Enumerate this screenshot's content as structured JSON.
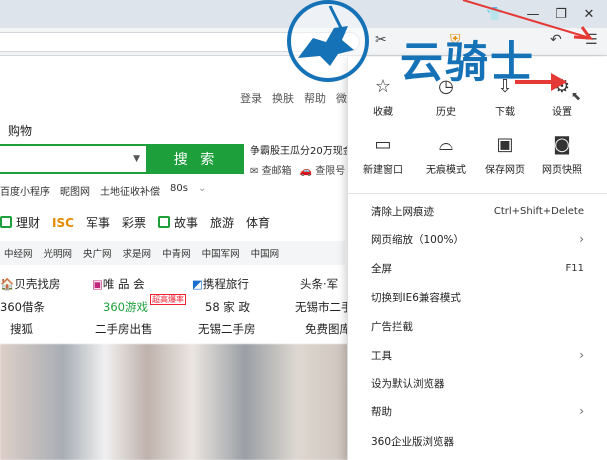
{
  "window": {
    "controls": [
      "shirt-icon",
      "minimize-icon",
      "restore-icon",
      "close-icon"
    ]
  },
  "page": {
    "toplinks": [
      "登录",
      "换肤",
      "帮助",
      "微"
    ],
    "tab": "购物",
    "search_button": "搜 索",
    "promo": "争霸股王瓜分20万现金",
    "promo_links": [
      "查邮箱",
      "查限号"
    ],
    "quick_links": [
      "百度小程序",
      "昵图网",
      "土地征收补偿",
      "80s"
    ],
    "categories": [
      "理财",
      "ISC",
      "军事",
      "彩票",
      "故事",
      "旅游",
      "体育"
    ],
    "linkbar": [
      "中经网",
      "光明网",
      "央广网",
      "求是网",
      "中青网",
      "中国军网",
      "中国网"
    ],
    "sites": {
      "r1": [
        "贝壳找房",
        "唯 品 会",
        "携程旅行",
        "头条·军"
      ],
      "r2": [
        "360借条",
        "360游戏",
        "58 家 政",
        "无锡市二手"
      ],
      "r3": [
        "搜狐",
        "二手房出售",
        "无锡二手房",
        "免费图库"
      ],
      "hot_badge": "超高爆率"
    }
  },
  "menu": {
    "grid": [
      {
        "label": "收藏",
        "icon": "star-icon"
      },
      {
        "label": "历史",
        "icon": "clock-icon"
      },
      {
        "label": "下载",
        "icon": "download-icon"
      },
      {
        "label": "设置",
        "icon": "gear-icon"
      },
      {
        "label": "新建窗口",
        "icon": "window-icon"
      },
      {
        "label": "无痕模式",
        "icon": "incognito-icon"
      },
      {
        "label": "保存网页",
        "icon": "save-icon"
      },
      {
        "label": "网页快照",
        "icon": "camera-icon"
      }
    ],
    "items": [
      {
        "label": "清除上网痕迹",
        "shortcut": "Ctrl+Shift+Delete"
      },
      {
        "label": "网页缩放（100%）",
        "shortcut": "›"
      },
      {
        "label": "全屏",
        "shortcut": "F11"
      },
      {
        "label": "切换到IE6兼容模式",
        "shortcut": ""
      },
      {
        "label": "广告拦截",
        "shortcut": ""
      },
      {
        "label": "工具",
        "shortcut": "›"
      },
      {
        "label": "设为默认浏览器",
        "shortcut": ""
      },
      {
        "label": "帮助",
        "shortcut": "›"
      },
      {
        "label": "360企业版浏览器",
        "shortcut": ""
      }
    ]
  },
  "logo": {
    "text": "云骑士"
  },
  "colors": {
    "accent": "#1d9f3c",
    "logo": "#1672b6",
    "arrow": "#e53935"
  }
}
